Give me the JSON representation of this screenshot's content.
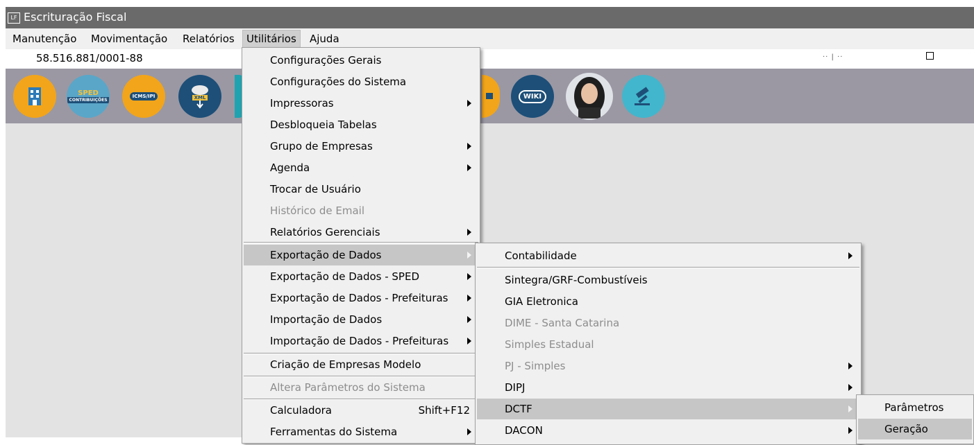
{
  "window": {
    "app_icon_text": "LF",
    "title": "Escrituração Fiscal"
  },
  "menubar": [
    "Manutenção",
    "Movimentação",
    "Relatórios",
    "Utilitários",
    "Ajuda"
  ],
  "infobar": {
    "cnpj": "58.516.881/0001-88",
    "right_text": "·· | ··"
  },
  "toolbar": {
    "sped_line1": "SPED",
    "sped_line2": "CONTRIBUIÇÕES",
    "icms_label": "ICMS/IPI",
    "xml_label": "XML",
    "wiki_label": "WIKI",
    "icons": [
      "building-icon",
      "sped-contribuicoes-icon",
      "icms-ipi-icon",
      "xml-download-icon",
      "partial-icon",
      "chat-icon",
      "wiki-icon",
      "assistant-avatar-icon",
      "gavel-icon"
    ]
  },
  "utilitarios_menu": {
    "items": [
      {
        "label": "Configurações Gerais"
      },
      {
        "label": "Configurações do Sistema"
      },
      {
        "label": "Impressoras",
        "submenu": true
      },
      {
        "label": "Desbloqueia Tabelas"
      },
      {
        "label": "Grupo de Empresas",
        "submenu": true
      },
      {
        "label": "Agenda",
        "submenu": true
      },
      {
        "label": "Trocar de Usuário"
      },
      {
        "label": "Histórico de Email",
        "disabled": true
      },
      {
        "label": "Relatórios Gerenciais",
        "submenu": true
      },
      {
        "label": "Exportação de Dados",
        "submenu": true,
        "highlighted": true
      },
      {
        "label": "Exportação de Dados - SPED",
        "submenu": true
      },
      {
        "label": "Exportação de Dados - Prefeituras",
        "submenu": true
      },
      {
        "label": "Importação de Dados",
        "submenu": true
      },
      {
        "label": "Importação de Dados - Prefeituras",
        "submenu": true
      },
      {
        "label": "Criação de Empresas Modelo"
      },
      {
        "label": "Altera Parâmetros do Sistema",
        "disabled": true
      },
      {
        "label": "Calculadora",
        "shortcut": "Shift+F12"
      },
      {
        "label": "Ferramentas do Sistema",
        "submenu": true
      }
    ]
  },
  "exportacao_submenu": {
    "items": [
      {
        "label": "Contabilidade",
        "submenu": true
      },
      {
        "label": "Sintegra/GRF-Combustíveis"
      },
      {
        "label": "GIA Eletronica"
      },
      {
        "label": "DIME - Santa Catarina",
        "disabled": true
      },
      {
        "label": "Simples Estadual",
        "disabled": true
      },
      {
        "label": "PJ - Simples",
        "disabled": true,
        "submenu": true
      },
      {
        "label": "DIPJ",
        "submenu": true
      },
      {
        "label": "DCTF",
        "submenu": true,
        "highlighted": true
      },
      {
        "label": "DACON",
        "submenu": true
      }
    ]
  },
  "dctf_submenu": {
    "items": [
      {
        "label": "Parâmetros"
      },
      {
        "label": "Geração",
        "highlighted": true
      }
    ]
  },
  "colors": {
    "titlebar": "#6a6a6a",
    "toolbar": "#9b98a3",
    "content": "#e3e3e3",
    "menu_bg": "#f0f0f0",
    "highlight": "#c6c6c6"
  }
}
